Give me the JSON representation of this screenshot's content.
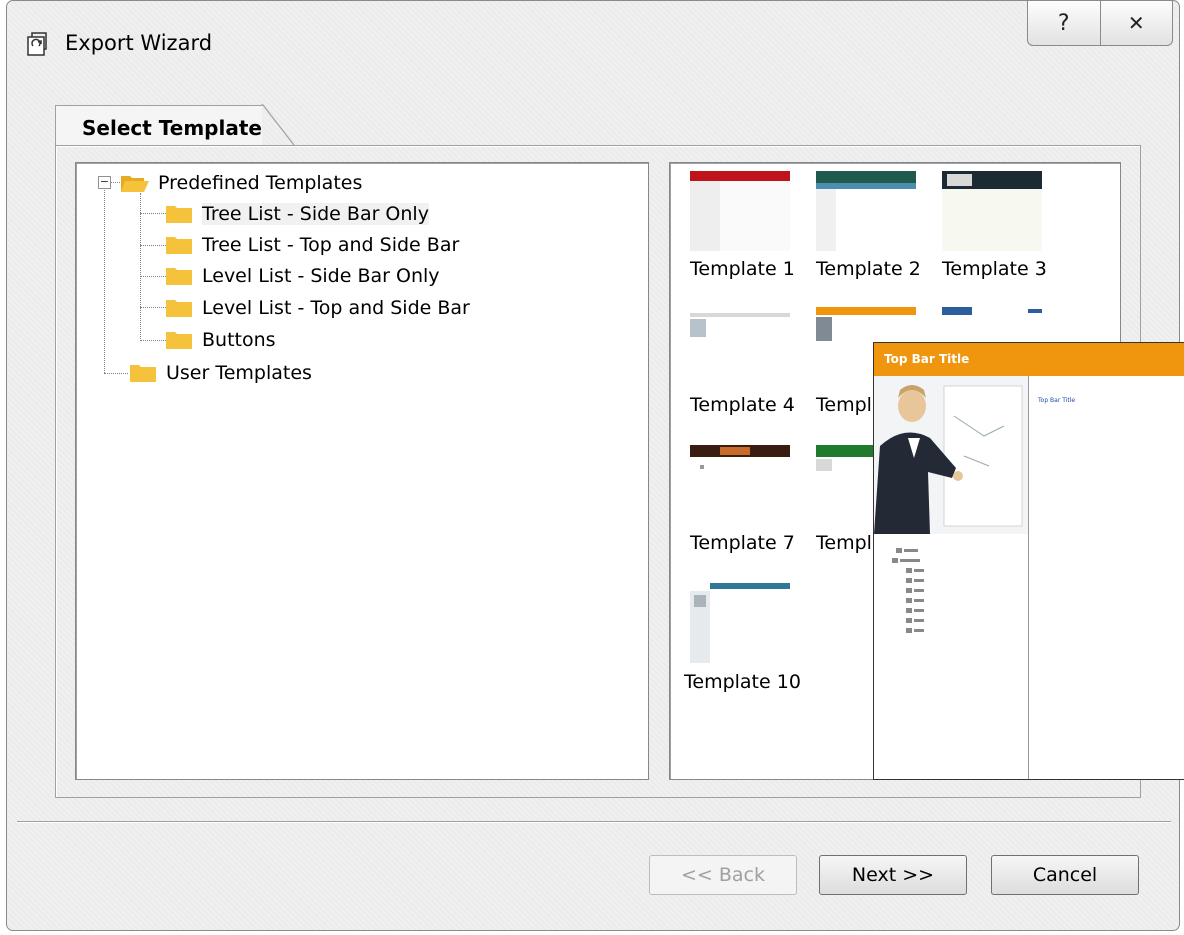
{
  "window": {
    "title": "Export Wizard",
    "help_glyph": "?",
    "close_glyph": "✕"
  },
  "tab": {
    "label": "Select Template"
  },
  "tree": {
    "root": "Predefined Templates",
    "children": [
      "Tree List - Side Bar Only",
      "Tree List - Top and Side Bar",
      "Level List - Side Bar Only",
      "Level List - Top and Side Bar",
      "Buttons"
    ],
    "user": "User Templates",
    "expander_glyph": "−"
  },
  "gallery": {
    "templates": [
      "Template 1",
      "Template 2",
      "Template 3",
      "Template 4",
      "Templ",
      "",
      "Template 7",
      "Templ",
      "",
      "Template 10"
    ]
  },
  "preview": {
    "top_bar_title": "Top Bar Title",
    "link_text": "Top Bar Title"
  },
  "buttons": {
    "back": "<< Back",
    "next": "Next >>",
    "cancel": "Cancel"
  },
  "colors": {
    "preview_bar": "#f0960e",
    "folder": "#f5c33b"
  }
}
